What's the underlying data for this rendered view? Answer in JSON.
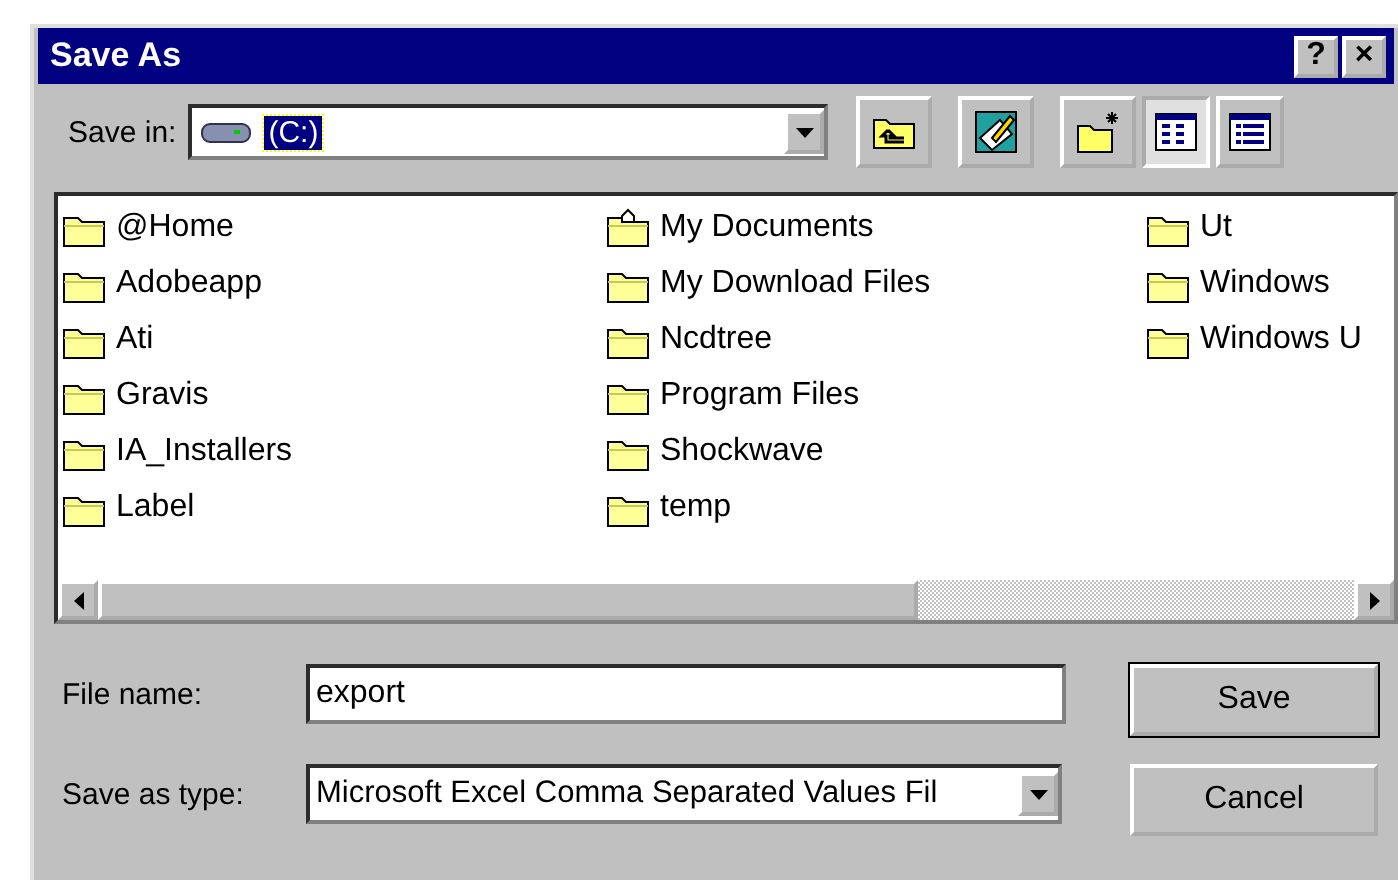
{
  "window": {
    "title": "Save As",
    "title_buttons": [
      "?",
      "×"
    ]
  },
  "save_in": {
    "label": "Save in:",
    "value": "(C:)"
  },
  "toolbar": [
    {
      "kind": "up"
    },
    {
      "kind": "desktop"
    },
    {
      "kind": "newfolder"
    },
    {
      "kind": "list",
      "selected": true
    },
    {
      "kind": "details",
      "selected": false
    }
  ],
  "files": [
    {
      "name": "@Home",
      "kind": "folder"
    },
    {
      "name": "Adobeapp",
      "kind": "folder"
    },
    {
      "name": "Ati",
      "kind": "folder"
    },
    {
      "name": "Gravis",
      "kind": "folder"
    },
    {
      "name": "IA_Installers",
      "kind": "folder"
    },
    {
      "name": "Label",
      "kind": "folder"
    },
    {
      "name": "My Documents",
      "kind": "documents"
    },
    {
      "name": "My Download Files",
      "kind": "folder"
    },
    {
      "name": "Ncdtree",
      "kind": "folder"
    },
    {
      "name": "Program Files",
      "kind": "folder"
    },
    {
      "name": "Shockwave",
      "kind": "folder"
    },
    {
      "name": "temp",
      "kind": "folder"
    },
    {
      "name": "Ut",
      "kind": "folder"
    },
    {
      "name": "Windows",
      "kind": "folder"
    },
    {
      "name": "Windows U",
      "kind": "folder"
    }
  ],
  "file_name": {
    "label": "File name:",
    "value": "export"
  },
  "save_as_type": {
    "label": "Save as type:",
    "value": "Microsoft Excel Comma Separated Values Fil"
  },
  "buttons": [
    {
      "label": "Save",
      "default": true
    },
    {
      "label": "Cancel",
      "default": false
    }
  ]
}
